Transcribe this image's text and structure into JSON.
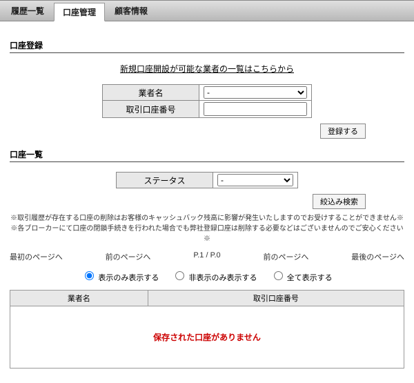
{
  "tabs": {
    "history": "履歴一覧",
    "account": "口座管理",
    "customer": "顧客情報"
  },
  "register": {
    "title": "口座登録",
    "link": "新規口座開設が可能な業者の一覧はこちらから",
    "broker_label": "業者名",
    "broker_selected": "-",
    "account_no_label": "取引口座番号",
    "account_no_value": "",
    "button": "登録する"
  },
  "list": {
    "title": "口座一覧",
    "status_label": "ステータス",
    "status_selected": "-",
    "search_button": "絞込み検索",
    "note1": "※取引履歴が存在する口座の削除はお客様のキャッシュバック残高に影響が発生いたしますのでお受けすることができません※",
    "note2": "※各ブローカーにて口座の閉鎖手続きを行われた場合でも弊社登録口座は削除する必要などはございませんのでご安心ください※",
    "pager": {
      "first": "最初のページへ",
      "prev": "前のページへ",
      "pos": "P.1 / P.0",
      "next": "前のページへ",
      "last": "最後のページへ"
    },
    "radios": {
      "show": "表示のみ表示する",
      "hide": "非表示のみ表示する",
      "all": "全て表示する"
    },
    "cols": {
      "broker": "業者名",
      "account_no": "取引口座番号"
    },
    "empty": "保存された口座がありません"
  }
}
